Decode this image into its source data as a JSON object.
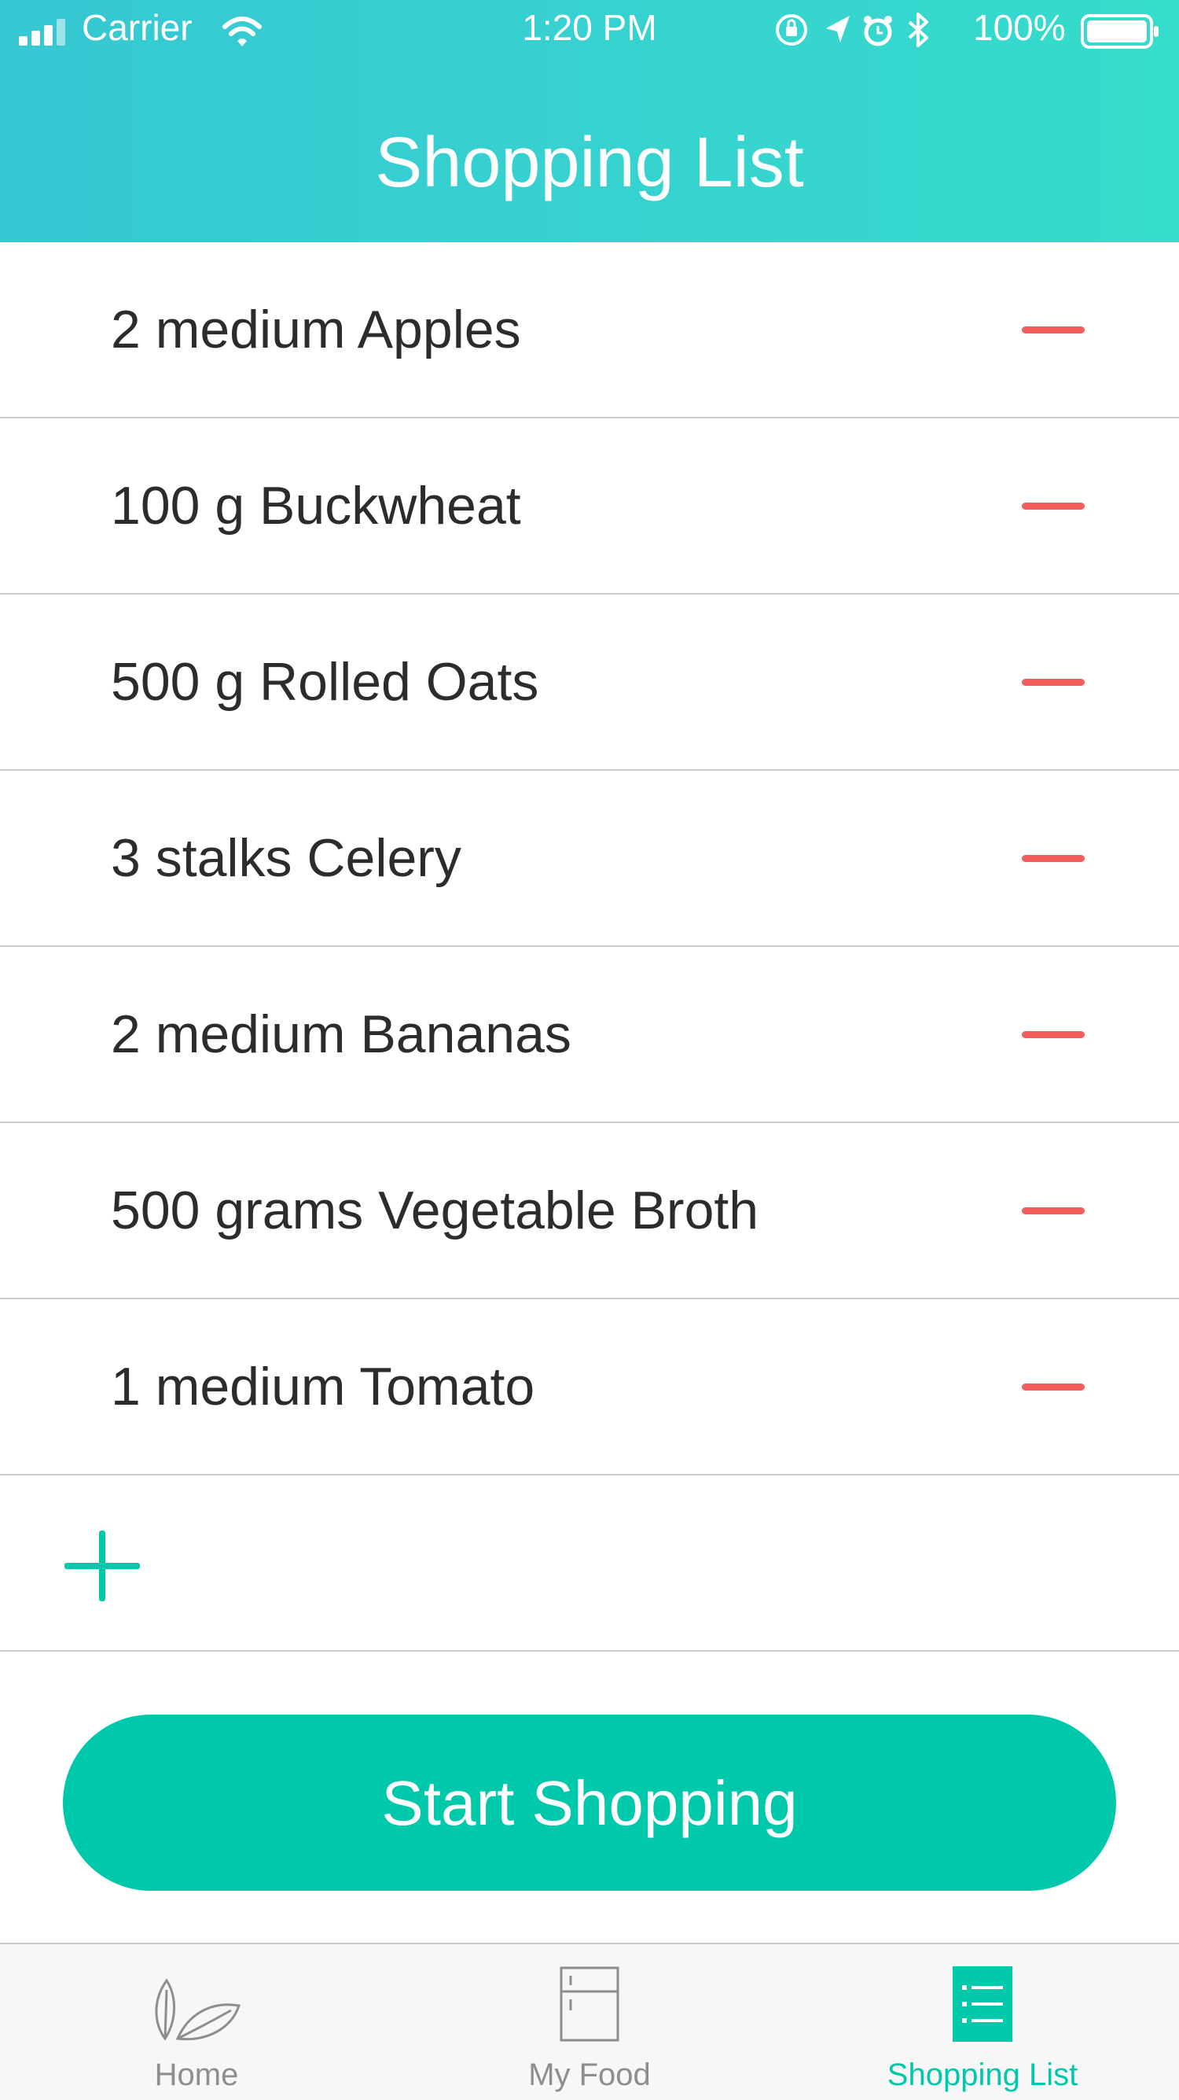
{
  "status_bar": {
    "carrier": "Carrier",
    "time": "1:20 PM",
    "battery_percent": "100%",
    "icons": [
      "signal-icon",
      "wifi-icon",
      "rotation-lock-icon",
      "location-icon",
      "alarm-icon",
      "bluetooth-icon",
      "battery-icon"
    ]
  },
  "header": {
    "title": "Shopping List"
  },
  "items": [
    {
      "label": "2 medium Apples"
    },
    {
      "label": "100 g Buckwheat"
    },
    {
      "label": "500 g Rolled Oats"
    },
    {
      "label": "3 stalks Celery"
    },
    {
      "label": "2 medium Bananas"
    },
    {
      "label": "500 grams Vegetable Broth"
    },
    {
      "label": "1 medium Tomato"
    }
  ],
  "add_icon": "plus-icon",
  "primary_action": {
    "label": "Start Shopping"
  },
  "tabs": [
    {
      "label": "Home",
      "icon": "leaves-icon",
      "active": false
    },
    {
      "label": "My Food",
      "icon": "fridge-icon",
      "active": false
    },
    {
      "label": "Shopping List",
      "icon": "list-icon",
      "active": true
    }
  ],
  "colors": {
    "header_gradient_start": "#36c7d3",
    "header_gradient_end": "#36dccc",
    "accent": "#00c9ab",
    "remove": "#f45d5d",
    "tab_inactive": "#8e8e8e",
    "text": "#2c2c2c"
  }
}
